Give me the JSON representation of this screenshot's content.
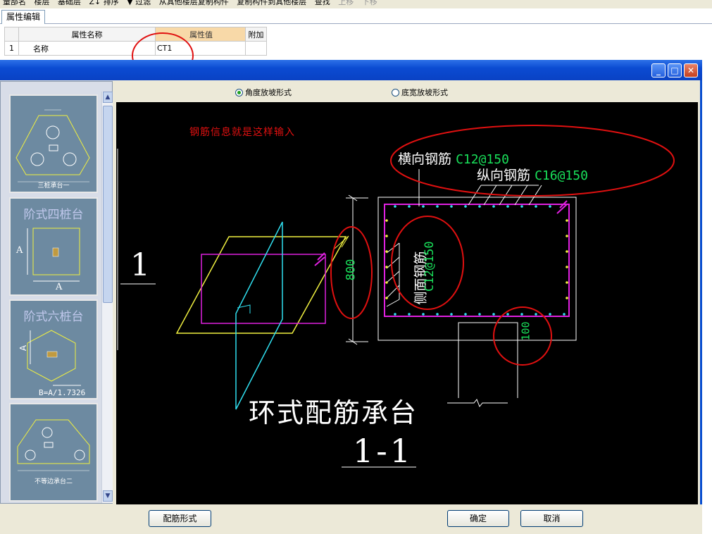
{
  "toolbar": {
    "items": [
      "量部名",
      "楼层",
      "基础层",
      "Z↓ 排序",
      "▼ 过滤",
      "从其他楼层复制构件",
      "复制构件到其他楼层",
      "查找",
      "上移",
      "下移"
    ]
  },
  "tab": {
    "label": "属性编辑"
  },
  "prop_table": {
    "headers": [
      "属性名称",
      "属性值",
      "附加"
    ],
    "row": {
      "index": "1",
      "name": "名称",
      "value": "CT1",
      "extra": ""
    }
  },
  "dialog": {
    "title": "",
    "radio_angle": "角度放坡形式",
    "radio_width": "底宽放坡形式",
    "buttons": {
      "rebar_form": "配筋形式",
      "ok": "确定",
      "cancel": "取消"
    }
  },
  "thumbnails": [
    {
      "caption": "三桩承台一"
    },
    {
      "title": "阶式四桩台",
      "dim_a": "A",
      "dim_b": "A"
    },
    {
      "title": "阶式六桩台",
      "dim_a": "A",
      "formula": "B=A/1.7326"
    },
    {
      "caption": "不等边承台二"
    }
  ],
  "drawing": {
    "note": "钢筋信息就是这样输入",
    "transverse_label": "横向钢筋",
    "transverse_value": "C12@150",
    "longitudinal_label": "纵向钢筋",
    "longitudinal_value": "C16@150",
    "side_label": "侧面钢筋",
    "side_value": "C12@150",
    "dim_height": "800",
    "dim_cover": "100",
    "section_number": "1",
    "main_title": "环式配筋承台",
    "section_title": "1-1"
  },
  "colors": {
    "accent_red": "#e01010",
    "rebar_green": "#19e05a",
    "stirrup_magenta": "#e020e0",
    "outline_yellow": "#f0f040",
    "cyan": "#30e0f0"
  }
}
